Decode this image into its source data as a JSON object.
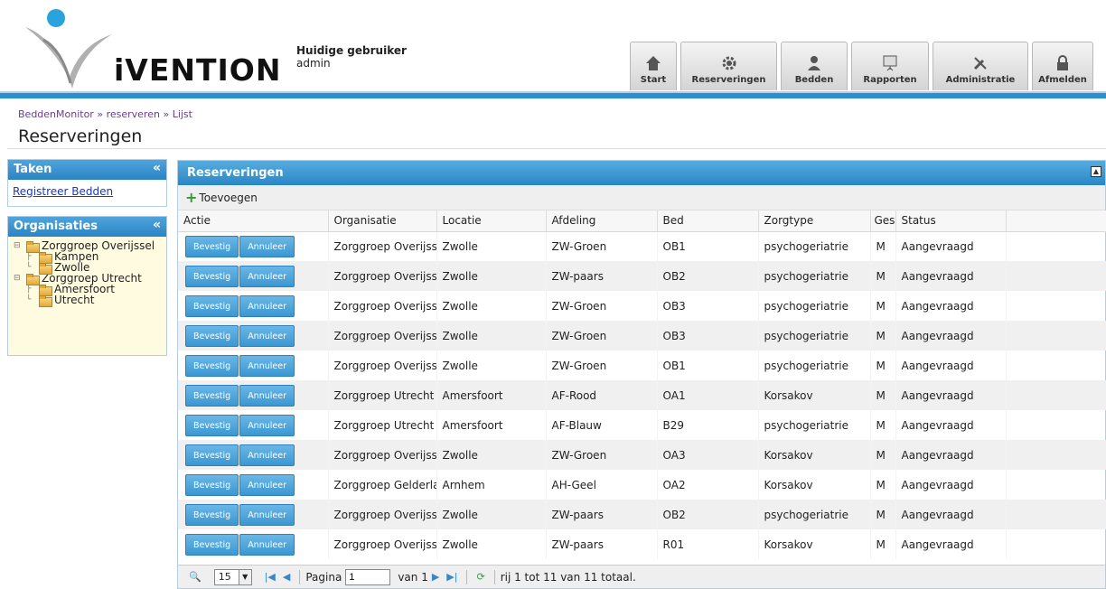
{
  "header": {
    "logo_text": "iVENTION",
    "user_label": "Huidige gebruiker",
    "user_name": "admin",
    "nav": [
      {
        "label": "Start",
        "icon": "home-icon"
      },
      {
        "label": "Reserveringen",
        "icon": "gear-icon"
      },
      {
        "label": "Bedden",
        "icon": "user-icon"
      },
      {
        "label": "Rapporten",
        "icon": "presentation-icon"
      },
      {
        "label": "Administratie",
        "icon": "tools-icon"
      },
      {
        "label": "Afmelden",
        "icon": "lock-icon"
      }
    ]
  },
  "breadcrumb": [
    "BeddenMonitor",
    "reserveren",
    "Lijst"
  ],
  "page_title": "Reserveringen",
  "sidebar": {
    "taken_title": "Taken",
    "taken_link": "Registreer Bedden",
    "org_title": "Organisaties",
    "tree": [
      {
        "label": "Zorggroep Overijssel",
        "children": [
          "Kampen",
          "Zwolle"
        ]
      },
      {
        "label": "Zorggroep Utrecht",
        "children": [
          "Amersfoort",
          "Utrecht"
        ]
      }
    ]
  },
  "grid": {
    "title": "Reserveringen",
    "add_label": "Toevoegen",
    "confirm_label": "Bevestig",
    "cancel_label": "Annuleer",
    "columns": [
      "Actie",
      "Organisatie",
      "Locatie",
      "Afdeling",
      "Bed",
      "Zorgtype",
      "Geslacht",
      "Status"
    ],
    "rows": [
      [
        "Zorggroep Overijssel",
        "Zwolle",
        "ZW-Groen",
        "OB1",
        "psychogeriatrie",
        "M",
        "Aangevraagd"
      ],
      [
        "Zorggroep Overijssel",
        "Zwolle",
        "ZW-paars",
        "OB2",
        "psychogeriatrie",
        "M",
        "Aangevraagd"
      ],
      [
        "Zorggroep Overijssel",
        "Zwolle",
        "ZW-Groen",
        "OB3",
        "psychogeriatrie",
        "M",
        "Aangevraagd"
      ],
      [
        "Zorggroep Overijssel",
        "Zwolle",
        "ZW-Groen",
        "OB3",
        "psychogeriatrie",
        "M",
        "Aangevraagd"
      ],
      [
        "Zorggroep Overijssel",
        "Zwolle",
        "ZW-Groen",
        "OB1",
        "psychogeriatrie",
        "M",
        "Aangevraagd"
      ],
      [
        "Zorggroep Utrecht",
        "Amersfoort",
        "AF-Rood",
        "OA1",
        "Korsakov",
        "M",
        "Aangevraagd"
      ],
      [
        "Zorggroep Utrecht",
        "Amersfoort",
        "AF-Blauw",
        "B29",
        "psychogeriatrie",
        "M",
        "Aangevraagd"
      ],
      [
        "Zorggroep Overijssel",
        "Zwolle",
        "ZW-Groen",
        "OA3",
        "Korsakov",
        "M",
        "Aangevraagd"
      ],
      [
        "Zorggroep Gelderland",
        "Arnhem",
        "AH-Geel",
        "OA2",
        "Korsakov",
        "M",
        "Aangevraagd"
      ],
      [
        "Zorggroep Overijssel",
        "Zwolle",
        "ZW-paars",
        "OB2",
        "psychogeriatrie",
        "M",
        "Aangevraagd"
      ],
      [
        "Zorggroep Overijssel",
        "Zwolle",
        "ZW-paars",
        "R01",
        "Korsakov",
        "M",
        "Aangevraagd"
      ]
    ]
  },
  "pager": {
    "page_size": "15",
    "page_label": "Pagina",
    "page_value": "1",
    "of_label": "van 1",
    "summary": "rij 1 tot 11 van 11 totaal."
  },
  "colors": {
    "accent": "#2e8fcf",
    "button": "#3b97d2",
    "tree_bg": "#fffbe0"
  }
}
